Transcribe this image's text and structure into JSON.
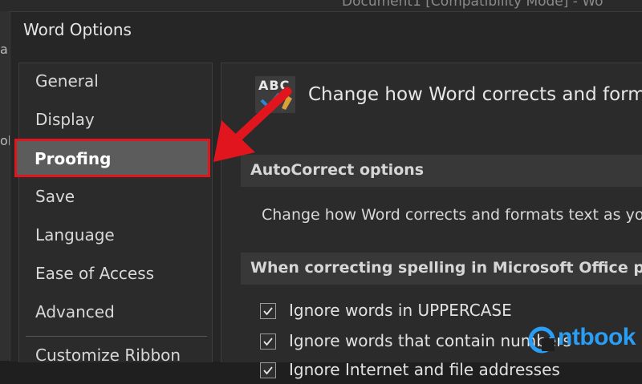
{
  "background_window": {
    "title": "Document1 [Compatibility Mode] - Wo",
    "edge_chars": [
      "a",
      "ok"
    ]
  },
  "dialog": {
    "title": "Word Options"
  },
  "nav": {
    "items": [
      {
        "label": "General"
      },
      {
        "label": "Display"
      },
      {
        "label": "Proofing",
        "selected": true
      },
      {
        "label": "Save"
      },
      {
        "label": "Language"
      },
      {
        "label": "Ease of Access"
      },
      {
        "label": "Advanced"
      },
      {
        "label": "Customize Ribbon"
      }
    ]
  },
  "content": {
    "icon": {
      "name": "abc-check-icon",
      "text": "ABC"
    },
    "header": "Change how Word corrects and formats",
    "autocorrect_section": "AutoCorrect options",
    "autocorrect_desc": "Change how Word corrects and formats text as you",
    "spelling_section": "When correcting spelling in Microsoft Office prog",
    "checks": [
      {
        "label": "Ignore words in UPPERCASE",
        "checked": true
      },
      {
        "label": "Ignore words that contain numbers",
        "checked": true
      },
      {
        "label": "Ignore Internet and file addresses",
        "checked": true
      }
    ]
  },
  "annotation": {
    "color": "#e0151d"
  },
  "watermark": {
    "text": "ntbook",
    "color": "#2a9df4"
  }
}
